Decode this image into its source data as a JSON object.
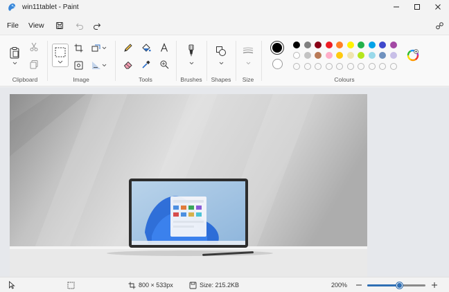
{
  "window": {
    "title": "win11tablet - Paint"
  },
  "menu": {
    "file": "File",
    "view": "View"
  },
  "ribbon": {
    "groups": {
      "clipboard": "Clipboard",
      "image": "Image",
      "tools": "Tools",
      "brushes": "Brushes",
      "shapes": "Shapes",
      "size": "Size",
      "colours": "Colours"
    },
    "palette": {
      "row1": [
        "#000000",
        "#7f7f7f",
        "#880015",
        "#ed1c24",
        "#ff7f27",
        "#fff200",
        "#22b14c",
        "#00a2e8",
        "#3f48cc",
        "#a349a4"
      ],
      "row2": [
        "#ffffff",
        "#c3c3c3",
        "#b97a57",
        "#ffaec9",
        "#ffc90e",
        "#efe4b0",
        "#b5e61d",
        "#99d9ea",
        "#7092be",
        "#c8bfe7"
      ]
    },
    "primary_color": "#000000",
    "secondary_color": "#ffffff"
  },
  "status": {
    "dimensions": "800 × 533px",
    "size": "Size: 215.2KB",
    "zoom": "200%",
    "zoom_level": 0.55
  }
}
